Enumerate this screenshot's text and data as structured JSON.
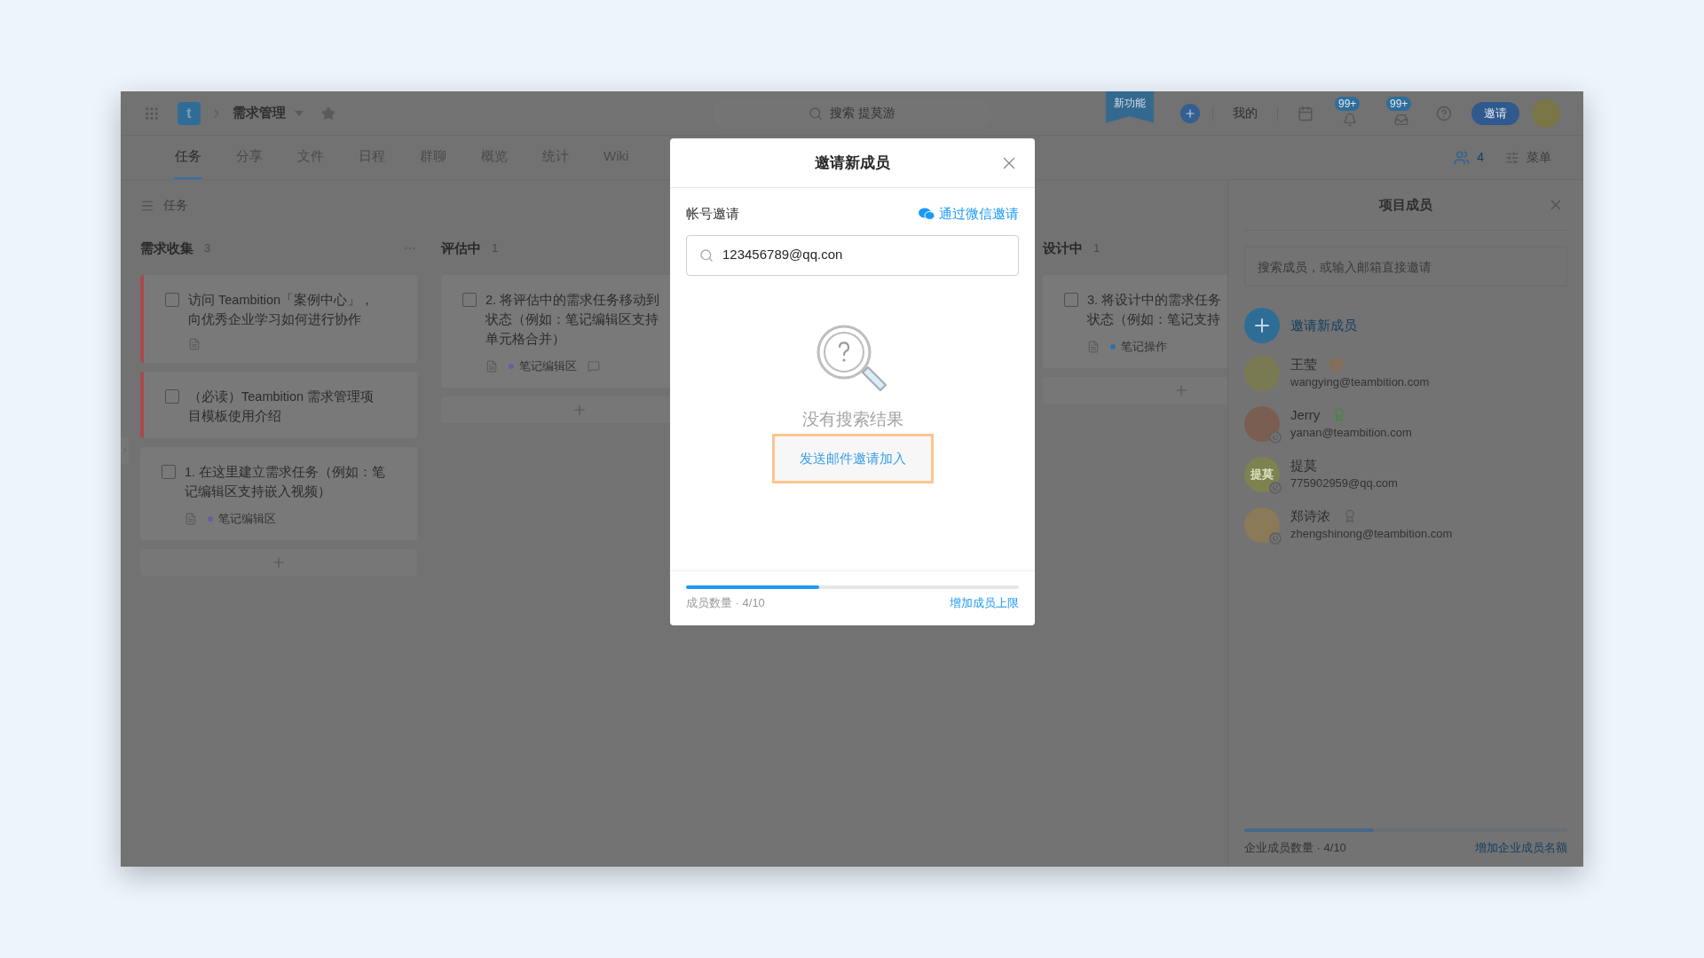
{
  "topbar": {
    "app_logo": "t",
    "project": "需求管理",
    "search_placeholder": "搜索 提莫游",
    "new_feature": "新功能",
    "mine": "我的",
    "notifications": [
      {
        "kind": "bell",
        "count": "99+"
      },
      {
        "kind": "inbox",
        "count": "99+"
      }
    ],
    "invite_button": "邀请"
  },
  "tabs": [
    {
      "label": "任务",
      "selected": true
    },
    {
      "label": "分享",
      "selected": false
    },
    {
      "label": "文件",
      "selected": false
    },
    {
      "label": "日程",
      "selected": false
    },
    {
      "label": "群聊",
      "selected": false
    },
    {
      "label": "概览",
      "selected": false
    },
    {
      "label": "统计",
      "selected": false
    },
    {
      "label": "Wiki",
      "selected": false
    }
  ],
  "toolbar": {
    "members_count": "4",
    "menu": "菜单"
  },
  "view_title": "任务",
  "columns": [
    {
      "title": "需求收集",
      "count": "3",
      "tasks": [
        {
          "lines": [
            "访问 Teambition「案例中心」，",
            "向优秀企业学习如何进行协作"
          ],
          "flagged": true,
          "note": true,
          "comment": false
        },
        {
          "lines": [
            "（必读）Teambition 需求管理项",
            "目模板使用介绍"
          ],
          "flagged": true,
          "note": false,
          "comment": false
        },
        {
          "lines": [
            "1. 在这里建立需求任务（例如：笔",
            "记编辑区支持嵌入视频）"
          ],
          "flagged": false,
          "note": true,
          "comment": false,
          "tag": {
            "label": "笔记编辑区",
            "color": "#64619e"
          }
        }
      ]
    },
    {
      "title": "评估中",
      "count": "1",
      "tasks": [
        {
          "lines": [
            "2. 将评估中的需求任务移动到",
            "状态（例如：笔记编辑区支持",
            "单元格合并）"
          ],
          "flagged": false,
          "note": true,
          "comment": true,
          "tag": {
            "label": "笔记编辑区",
            "color": "#64619e"
          }
        }
      ]
    },
    {
      "title": "设计中",
      "count": "1",
      "tasks": [
        {
          "lines": [
            "3. 将设计中的需求任务",
            "状态（例如：笔记支持"
          ],
          "flagged": false,
          "note": true,
          "comment": false,
          "tag": {
            "label": "笔记操作",
            "color": "#2f6fa6"
          }
        }
      ]
    }
  ],
  "panel": {
    "title": "项目成员",
    "search_placeholder": "搜索成员，或输入邮箱直接邀请",
    "invite": "邀请新成员",
    "members": [
      {
        "name": "王莹",
        "email": "wangying@teambition.com",
        "kind": "owner",
        "away": false
      },
      {
        "name": "Jerry",
        "email": "yanan@teambition.com",
        "kind": "admin",
        "away": true
      },
      {
        "name": "提莫",
        "email": "775902959@qq.com",
        "kind": "plain",
        "avatar_text": "提莫",
        "away": true
      },
      {
        "name": "郑诗浓",
        "email": "zhengshinong@teambition.com",
        "kind": "member",
        "away": true
      }
    ],
    "quota": {
      "level": 0.4,
      "label": "企业成员数量 · 4/10",
      "link": "增加企业成员名额"
    }
  },
  "modal": {
    "title": "邀请新成员",
    "section": "帐号邀请",
    "wechat_link": "通过微信邀请",
    "search_value": "123456789@qq.con",
    "empty_text": "没有搜索结果",
    "send_button": "发送邮件邀请加入",
    "send_button_focused": true,
    "quota": {
      "level": 0.4,
      "label": "成员数量 · 4/10",
      "link": "增加成员上限"
    }
  }
}
